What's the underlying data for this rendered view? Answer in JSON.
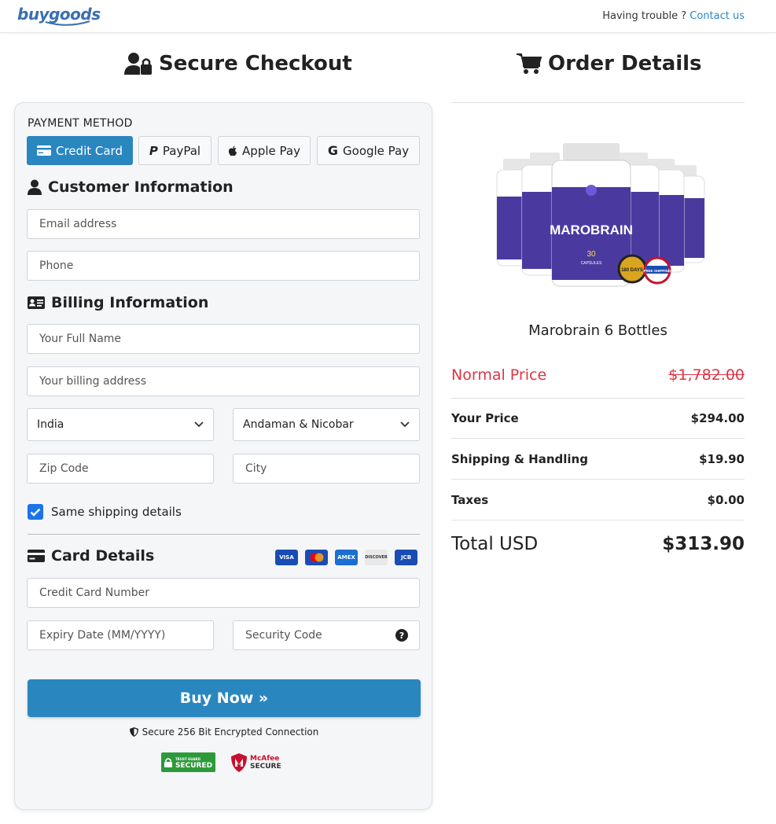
{
  "header": {
    "logo_buy": "buy",
    "logo_goods": "goods",
    "trouble_text": "Having trouble ?",
    "contact_link": "Contact us"
  },
  "checkout": {
    "title": "Secure Checkout",
    "payment_method_label": "PAYMENT METHOD",
    "payment_methods": [
      {
        "label": "Credit Card",
        "active": true
      },
      {
        "label": "PayPal",
        "active": false
      },
      {
        "label": "Apple Pay",
        "active": false
      },
      {
        "label": "Google Pay",
        "active": false
      }
    ],
    "customer_title": "Customer Information",
    "email_placeholder": "Email address",
    "phone_placeholder": "Phone",
    "billing_title": "Billing Information",
    "full_name_placeholder": "Your Full Name",
    "address_placeholder": "Your billing address",
    "country_value": "India",
    "state_value": "Andaman & Nicobar",
    "zip_placeholder": "Zip Code",
    "city_placeholder": "City",
    "same_shipping_label": "Same shipping details",
    "same_shipping_checked": true,
    "card_title": "Card Details",
    "card_brands": [
      "VISA",
      "mastercard",
      "AMEX",
      "DISCOVER",
      "JCB"
    ],
    "card_number_placeholder": "Credit Card Number",
    "expiry_placeholder": "Expiry Date (MM/YYYY)",
    "security_placeholder": "Security Code",
    "buy_button": "Buy Now »",
    "secure_text": "Secure 256 Bit Encrypted Connection",
    "trust_badge": "SECURED",
    "trust_badge_top": "TRUST GUARD",
    "mcafee_line1": "McAfee",
    "mcafee_line2": "SECURE"
  },
  "order": {
    "title": "Order Details",
    "product_name": "Marobrain 6 Bottles",
    "product_brand_text": "MAROBRAIN",
    "product_capsules": "30",
    "product_capsules_label": "CAPSULES",
    "seal_days": "180 DAYS",
    "seal_shipping": "FREE SHIPPING",
    "normal_price_label": "Normal Price",
    "normal_price": "$1,782.00",
    "your_price_label": "Your Price",
    "your_price": "$294.00",
    "shipping_label": "Shipping & Handling",
    "shipping": "$19.90",
    "taxes_label": "Taxes",
    "taxes": "$0.00",
    "total_label": "Total USD",
    "total": "$313.90"
  },
  "colors": {
    "primary": "#2a86bf",
    "strike_red": "#dc3545",
    "link": "#2a86c6",
    "bottle_purple": "#4a3aa0"
  }
}
